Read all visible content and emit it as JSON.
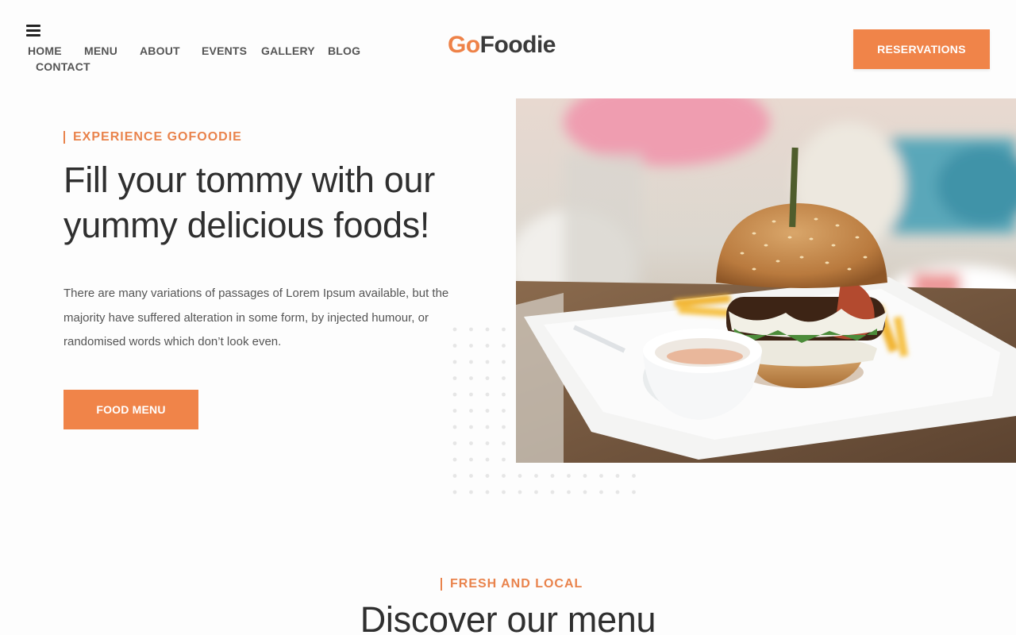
{
  "header": {
    "menu_icon": "hamburger-menu-icon",
    "nav": {
      "home": "HOME",
      "menu": "MENU",
      "about": "ABOUT",
      "events": "EVENTS",
      "gallery": "GALLERY",
      "blog": "BLOG",
      "contact": "CONTACT"
    },
    "logo": {
      "part1": "Go",
      "part2": "Foodie"
    },
    "reservations_label": "RESERVATIONS"
  },
  "hero": {
    "eyebrow": "EXPERIENCE GOFOODIE",
    "title": "Fill your tommy with our yummy delicious foods!",
    "text": "There are many variations of passages of Lorem Ipsum available, but the majority have suffered alteration in some form, by injected humour, or randomised words which don’t look even.",
    "button_label": "FOOD MENU",
    "image": "burger-on-plate-photo"
  },
  "menu_section": {
    "eyebrow": "FRESH AND LOCAL",
    "title": "Discover our menu"
  },
  "colors": {
    "accent": "#f08449",
    "accent_text": "#e9834c",
    "heading": "#2f2f2f",
    "body_text": "#555555"
  }
}
